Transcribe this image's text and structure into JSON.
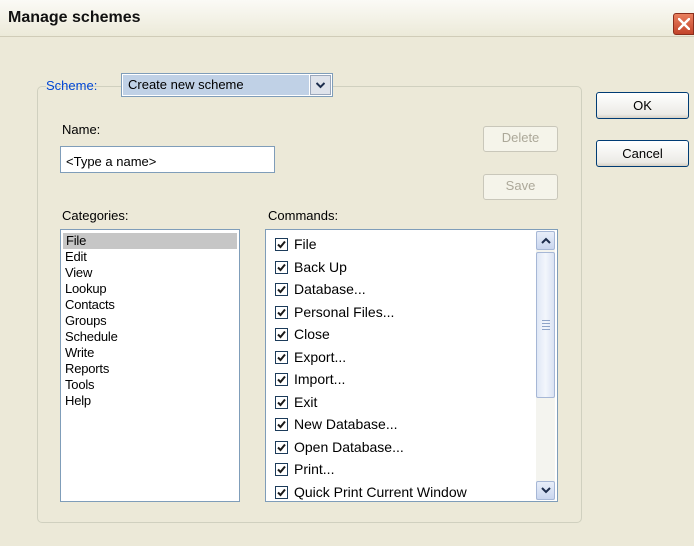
{
  "window": {
    "title": "Manage schemes"
  },
  "scheme": {
    "label": "Scheme:",
    "selected": "Create new scheme"
  },
  "name": {
    "label": "Name:",
    "value": "<Type a name>"
  },
  "buttons": {
    "delete": "Delete",
    "save": "Save",
    "ok": "OK",
    "cancel": "Cancel"
  },
  "categories": {
    "label": "Categories:",
    "selected_index": 0,
    "items": [
      "File",
      "Edit",
      "View",
      "Lookup",
      "Contacts",
      "Groups",
      "Schedule",
      "Write",
      "Reports",
      "Tools",
      "Help"
    ]
  },
  "commands": {
    "label": "Commands:",
    "items": [
      {
        "label": "File",
        "checked": true
      },
      {
        "label": "Back Up",
        "checked": true
      },
      {
        "label": "Database...",
        "checked": true
      },
      {
        "label": "Personal Files...",
        "checked": true
      },
      {
        "label": "Close",
        "checked": true
      },
      {
        "label": "Export...",
        "checked": true
      },
      {
        "label": "Import...",
        "checked": true
      },
      {
        "label": "Exit",
        "checked": true
      },
      {
        "label": "New Database...",
        "checked": true
      },
      {
        "label": "Open Database...",
        "checked": true
      },
      {
        "label": "Print...",
        "checked": true
      },
      {
        "label": "Quick Print Current Window",
        "checked": true
      }
    ]
  },
  "icons": {
    "close": "close-icon",
    "dropdown": "chevron-down-icon",
    "check": "checkmark-icon",
    "scroll_up": "arrow-up-icon",
    "scroll_down": "arrow-down-icon"
  }
}
